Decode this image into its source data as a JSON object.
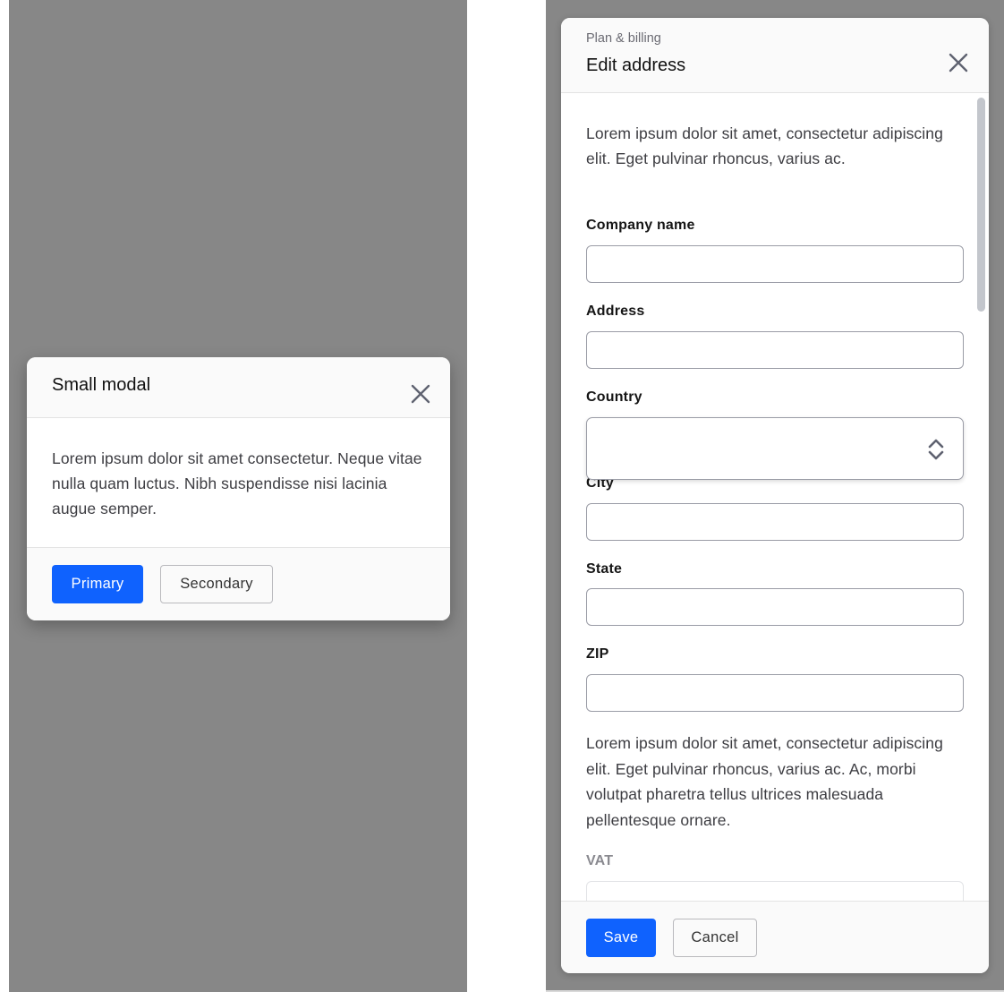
{
  "small_modal": {
    "title": "Small modal",
    "close_icon": "close-icon",
    "body_text": "Lorem ipsum dolor sit amet consectetur. Neque vitae nulla quam luctus. Nibh suspendisse nisi lacinia augue semper.",
    "primary_label": "Primary",
    "secondary_label": "Secondary"
  },
  "edit_address_modal": {
    "eyebrow": "Plan & billing",
    "title": "Edit address",
    "close_icon": "close-icon",
    "intro_text": "Lorem ipsum dolor sit amet, consectetur adipiscing elit. Eget pulvinar rhoncus, varius ac.",
    "fields": {
      "company_name": {
        "label": "Company name",
        "value": ""
      },
      "address": {
        "label": "Address",
        "value": ""
      },
      "country": {
        "label": "Country",
        "value": "",
        "icon": "chevron-up-down-icon"
      },
      "city": {
        "label": "City",
        "value": ""
      },
      "state": {
        "label": "State",
        "value": ""
      },
      "zip": {
        "label": "ZIP",
        "value": ""
      },
      "vat": {
        "label": "VAT",
        "value": ""
      }
    },
    "note_text": "Lorem ipsum dolor sit amet, consectetur adipiscing elit. Eget pulvinar rhoncus, varius ac. Ac, morbi volutpat pharetra tellus ultrices malesuada pellentesque ornare.",
    "save_label": "Save",
    "cancel_label": "Cancel"
  },
  "colors": {
    "primary": "#0f62fe",
    "overlay": "#878787",
    "header_bg": "#fafafa"
  }
}
